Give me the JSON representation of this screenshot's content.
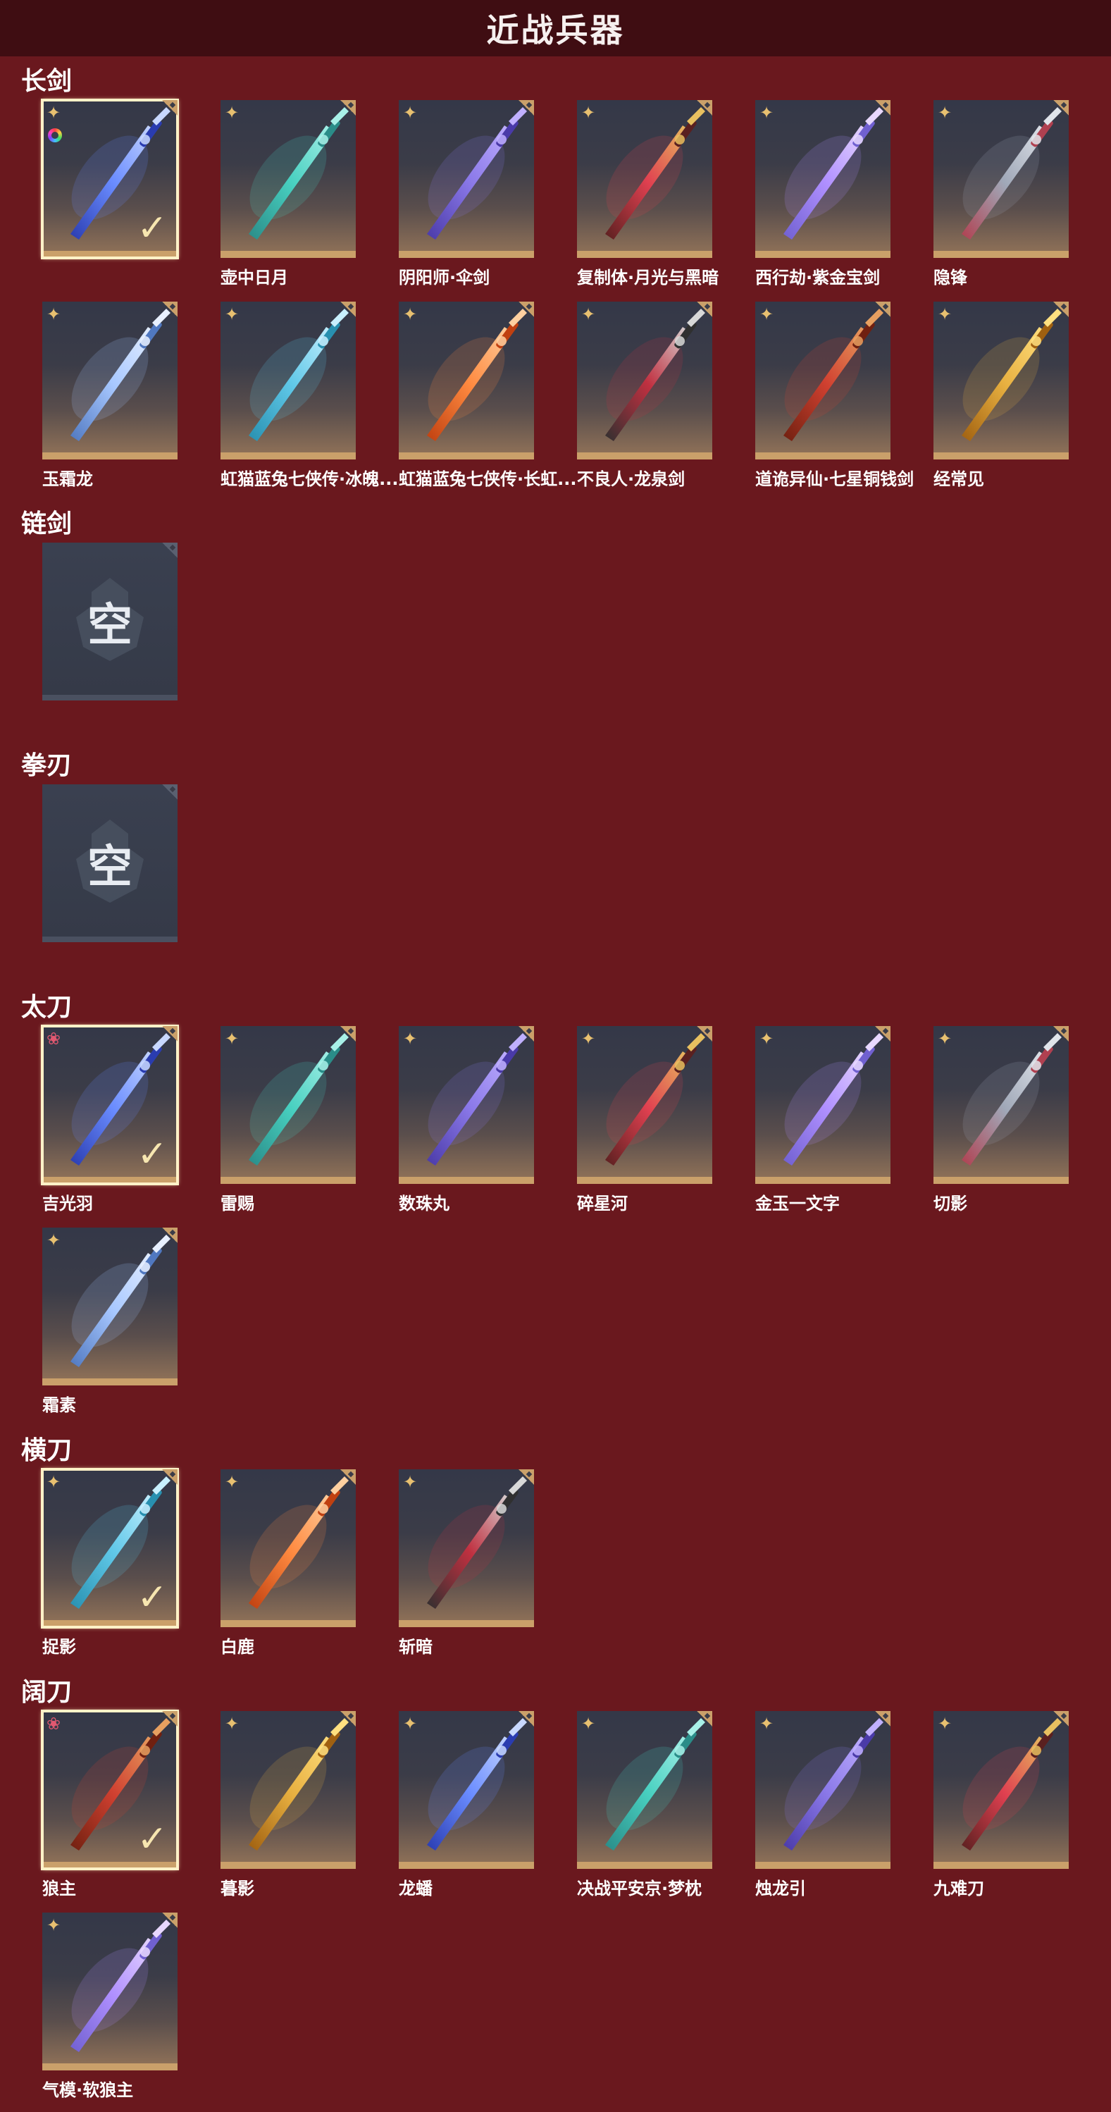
{
  "header": {
    "title": "近战兵器"
  },
  "sections": [
    {
      "title": "长剑",
      "items": [
        {
          "name": "",
          "rarity": "gold",
          "selected": true,
          "ring": true
        },
        {
          "name": "壶中日月",
          "rarity": "gold"
        },
        {
          "name": "阴阳师·伞剑",
          "rarity": "gold"
        },
        {
          "name": "复制体·月光与黑暗",
          "rarity": "gold"
        },
        {
          "name": "西行劫·紫金宝剑",
          "rarity": "gold"
        },
        {
          "name": "隐锋",
          "rarity": "gold"
        },
        {
          "name": "玉霜龙",
          "rarity": "gold"
        },
        {
          "name": "虹猫蓝兔七侠传·冰魄...",
          "rarity": "gold"
        },
        {
          "name": "虹猫蓝兔七侠传·长虹...",
          "rarity": "gold"
        },
        {
          "name": "不良人·龙泉剑",
          "rarity": "gold"
        },
        {
          "name": "道诡异仙·七星铜钱剑",
          "rarity": "gold"
        },
        {
          "name": "经常见",
          "rarity": "gold"
        }
      ]
    },
    {
      "title": "链剑",
      "empty_text": "空"
    },
    {
      "title": "拳刃",
      "empty_text": "空"
    },
    {
      "title": "太刀",
      "items": [
        {
          "name": "吉光羽",
          "rarity": "red",
          "selected": true
        },
        {
          "name": "雷赐",
          "rarity": "gold"
        },
        {
          "name": "数珠丸",
          "rarity": "gold"
        },
        {
          "name": "碎星河",
          "rarity": "gold"
        },
        {
          "name": "金玉一文字",
          "rarity": "gold"
        },
        {
          "name": "切影",
          "rarity": "gold"
        },
        {
          "name": "霜素",
          "rarity": "gold"
        }
      ]
    },
    {
      "title": "横刀",
      "items": [
        {
          "name": "捉影",
          "rarity": "gold",
          "selected": true
        },
        {
          "name": "白鹿",
          "rarity": "gold"
        },
        {
          "name": "斩暗",
          "rarity": "gold"
        }
      ]
    },
    {
      "title": "阔刀",
      "items": [
        {
          "name": "狼主",
          "rarity": "red",
          "selected": true
        },
        {
          "name": "暮影",
          "rarity": "gold"
        },
        {
          "name": "龙蟠",
          "rarity": "gold"
        },
        {
          "name": "决战平安京·梦枕",
          "rarity": "gold"
        },
        {
          "name": "烛龙引",
          "rarity": "gold"
        },
        {
          "name": "九难刀",
          "rarity": "gold"
        },
        {
          "name": "气模·软狼主",
          "rarity": "gold"
        }
      ]
    }
  ],
  "icons": {
    "rarity_gold": "four-point-star-icon",
    "rarity_red": "flower-icon",
    "selected": "checkmark-icon",
    "empty": "helmet-emblem-icon"
  },
  "colors": {
    "background": "#6a181e",
    "header": "#3f0d12",
    "card_accent": "#caa06a",
    "selected_border": "#fff2c8"
  }
}
